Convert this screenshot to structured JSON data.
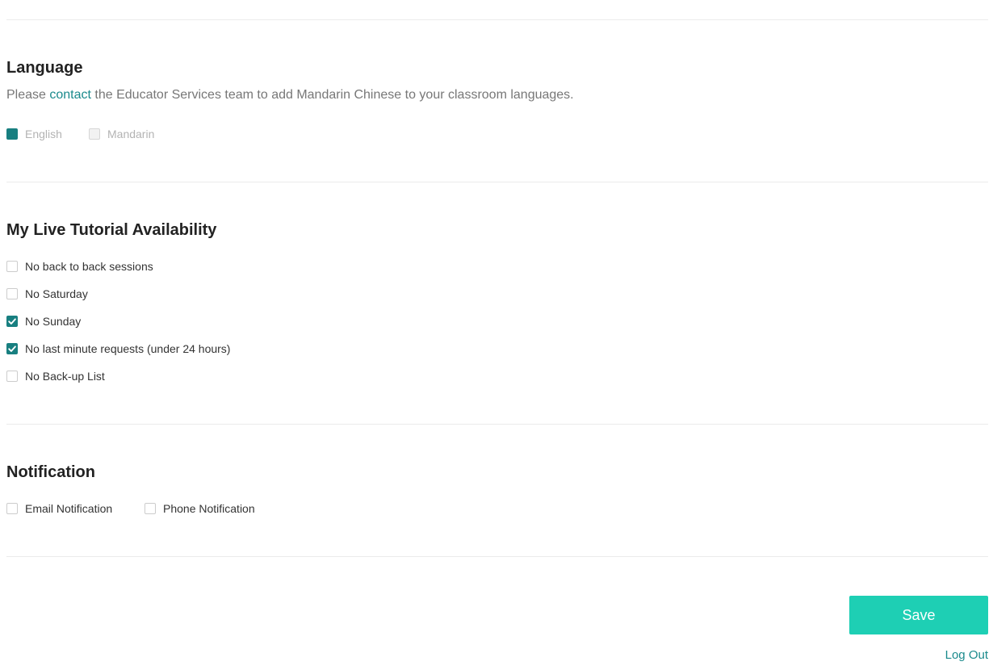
{
  "language": {
    "title": "Language",
    "description_before": "Please ",
    "description_link": "contact",
    "description_after": " the Educator Services team to add Mandarin Chinese to your classroom languages.",
    "options": [
      {
        "label": "English",
        "checked": true,
        "disabled": true
      },
      {
        "label": "Mandarin",
        "checked": false,
        "disabled": true
      }
    ]
  },
  "availability": {
    "title": "My Live Tutorial Availability",
    "options": [
      {
        "label": "No back to back sessions",
        "checked": false
      },
      {
        "label": "No Saturday",
        "checked": false
      },
      {
        "label": "No Sunday",
        "checked": true
      },
      {
        "label": "No last minute requests (under 24 hours)",
        "checked": true
      },
      {
        "label": "No Back-up List",
        "checked": false
      }
    ]
  },
  "notification": {
    "title": "Notification",
    "options": [
      {
        "label": "Email Notification",
        "checked": false
      },
      {
        "label": "Phone Notification",
        "checked": false
      }
    ]
  },
  "actions": {
    "save_label": "Save",
    "logout_label": "Log Out"
  },
  "colors": {
    "accent_teal": "#187f80",
    "link_teal": "#1a8a8c",
    "save_button": "#1ecfb4",
    "divider": "#ebebeb"
  }
}
